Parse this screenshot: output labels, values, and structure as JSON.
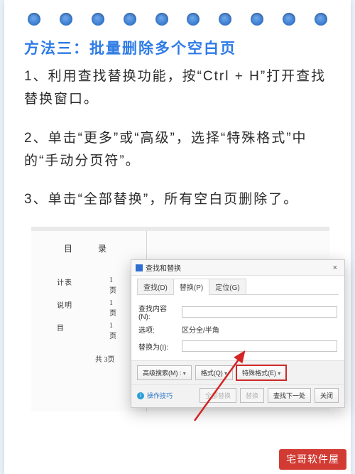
{
  "heading": "方法三：批量删除多个空白页",
  "p1": "1、利用查找替换功能，按“Ctrl + H”打开查找替换窗口。",
  "p2": "2、单击“更多”或“高级”，选择“特殊格式”中的“手动分页符”。",
  "p3": "3、单击“全部替换”，所有空白页删除了。",
  "toc": {
    "title": "目　录",
    "rows": [
      {
        "label": "计表",
        "page": "1 页"
      },
      {
        "label": "说明",
        "page": "1 页"
      },
      {
        "label": "目",
        "page": "1 页"
      }
    ],
    "total": "共 3页"
  },
  "dialog": {
    "title": "查找和替换",
    "tabs": {
      "find": "查找(D)",
      "replace": "替换(P)",
      "goto": "定位(G)"
    },
    "labels": {
      "findwhat": "查找内容(N):",
      "options": "选项:",
      "replacewith": "替换为(I):"
    },
    "options_text": "区分全/半角",
    "buttons": {
      "more": "高级搜索(M) :",
      "format": "格式(Q)",
      "special": "特殊格式(E)",
      "replaceall": "全部替换",
      "replace": "替换",
      "findnext": "查找下一处",
      "close": "关闭"
    },
    "tip": "操作技巧"
  },
  "watermark": {
    "main": "宅哥软件屋"
  }
}
